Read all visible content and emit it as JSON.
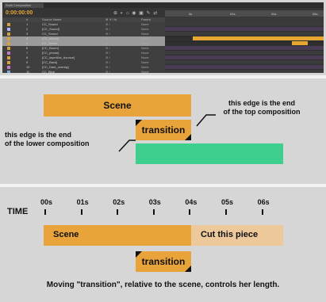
{
  "timeline": {
    "tab_label": "Solid Composition",
    "timecode": "0:00:00:00",
    "tools_glyphs": "⊕ ◐ ⌂ ◉ ▣ ✎ ⇄",
    "ruler_ticks": [
      "",
      "0s",
      "",
      "02s",
      "",
      "04s",
      "",
      "06s"
    ],
    "header": {
      "num": "#",
      "source": "Source Name",
      "switches": "⊕ ✳ \\ fx",
      "parent": "Parent"
    },
    "layers": [
      {
        "num": "1",
        "name": "CC_Sound",
        "color": "#d9a13b",
        "selected": false,
        "parent": "None"
      },
      {
        "num": "2",
        "name": "[CC_Sound]",
        "color": "#b0b0ff",
        "selected": false,
        "parent": "None"
      },
      {
        "num": "3",
        "name": "CC_Sound",
        "color": "#d9a13b",
        "selected": false,
        "parent": "None"
      },
      {
        "num": "4",
        "name": "[CC_elleau]",
        "color": "#d9a13b",
        "selected": true,
        "parent": "None"
      },
      {
        "num": "5",
        "name": "CC_Sceen",
        "color": "#d9a13b",
        "selected": true,
        "parent": "None"
      },
      {
        "num": "6",
        "name": "[CC_Boom]",
        "color": "#d9a13b",
        "selected": false,
        "parent": "None"
      },
      {
        "num": "7",
        "name": "[CC_phone]",
        "color": "#c87ac8",
        "selected": false,
        "parent": "None"
      },
      {
        "num": "8",
        "name": "[CC_layerAbc_bounce]",
        "color": "#d9a13b",
        "selected": false,
        "parent": "None"
      },
      {
        "num": "9",
        "name": "[CC_Back]",
        "color": "#d9a13b",
        "selected": false,
        "parent": "None"
      },
      {
        "num": "10",
        "name": "[CC_Dark_overlay]",
        "color": "#c87ac8",
        "selected": false,
        "parent": "None"
      },
      {
        "num": "11",
        "name": "CC_Blue",
        "color": "#7aa6d9",
        "selected": false,
        "parent": "None"
      }
    ]
  },
  "diagram1": {
    "scene_label": "Scene",
    "transition_label": "transition",
    "note_top_line1": "this edge is the end",
    "note_top_line2": "of the top composition",
    "note_low_line1": "this edge is the end",
    "note_low_line2": "of the lower composition",
    "colors": {
      "orange": "#e8a33a",
      "green": "#3ccf8e"
    }
  },
  "diagram2": {
    "time_label": "TIME",
    "ticks": [
      "00s",
      "01s",
      "02s",
      "03s",
      "04s",
      "05s",
      "06s"
    ],
    "scene_label": "Scene",
    "cut_label": "Cut this piece",
    "transition_label": "transition",
    "caption": "Moving \"transition\", relative to the  scene, controls her length.",
    "colors": {
      "orange": "#e8a33a",
      "light_orange": "#ecc89a"
    }
  }
}
